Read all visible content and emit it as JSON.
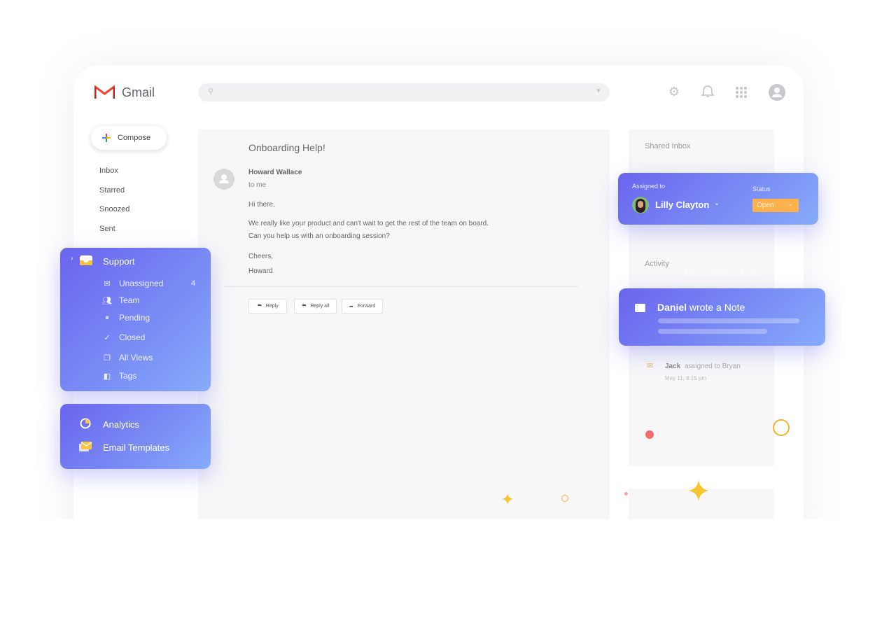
{
  "app": {
    "name": "Gmail",
    "brand_colors": {
      "red": "#ea4335",
      "accent_gradient": [
        "#6a64ee",
        "#87abfb"
      ],
      "status_orange": "#fbb24c"
    }
  },
  "header": {
    "search_placeholder": "",
    "icons": [
      "gear-icon",
      "bell-icon",
      "apps-grid-icon",
      "account-icon"
    ]
  },
  "sidebar": {
    "compose_label": "Compose",
    "items": [
      {
        "label": "Inbox"
      },
      {
        "label": "Starred"
      },
      {
        "label": "Snoozed"
      },
      {
        "label": "Sent"
      }
    ]
  },
  "support": {
    "title": "Support",
    "items": [
      {
        "label": "Unassigned",
        "count": "4",
        "icon": "envelope-open-icon"
      },
      {
        "label": "Team",
        "icon": "team-icon"
      },
      {
        "label": "Pending",
        "icon": "pause-icon"
      },
      {
        "label": "Closed",
        "icon": "check-circle-icon"
      },
      {
        "label": "All Views",
        "icon": "copy-icon"
      },
      {
        "label": "Tags",
        "icon": "tag-icon"
      }
    ]
  },
  "extras": {
    "items": [
      {
        "label": "Analytics",
        "icon": "pie-chart-icon"
      },
      {
        "label": "Email Templates",
        "icon": "email-templates-icon"
      }
    ]
  },
  "email": {
    "subject": "Onboarding Help!",
    "sender": "Howard Wallace",
    "to": "to me",
    "greeting": "Hi there,",
    "body_line1": "We really like your product and can't wait to get the rest of the team on board.",
    "body_line2": "Can you help us with an onboarding session?",
    "signoff": "Cheers,",
    "signature": "Howard",
    "actions": {
      "reply": "Reply",
      "reply_all": "Reply all",
      "forward": "Forward"
    }
  },
  "right": {
    "shared_inbox": "Shared Inbox",
    "activity": "Activity"
  },
  "assign": {
    "label": "Assigned to",
    "assignee": "Lilly Clayton",
    "status_label": "Status",
    "status_value": "Open"
  },
  "note": {
    "author": "Daniel",
    "text": " wrote a Note",
    "ghost": "Daniel wrote a Note"
  },
  "activity_item": {
    "actor": "Jack",
    "text": "assigned to Bryan",
    "time": "May 11, 8:15 pm"
  }
}
